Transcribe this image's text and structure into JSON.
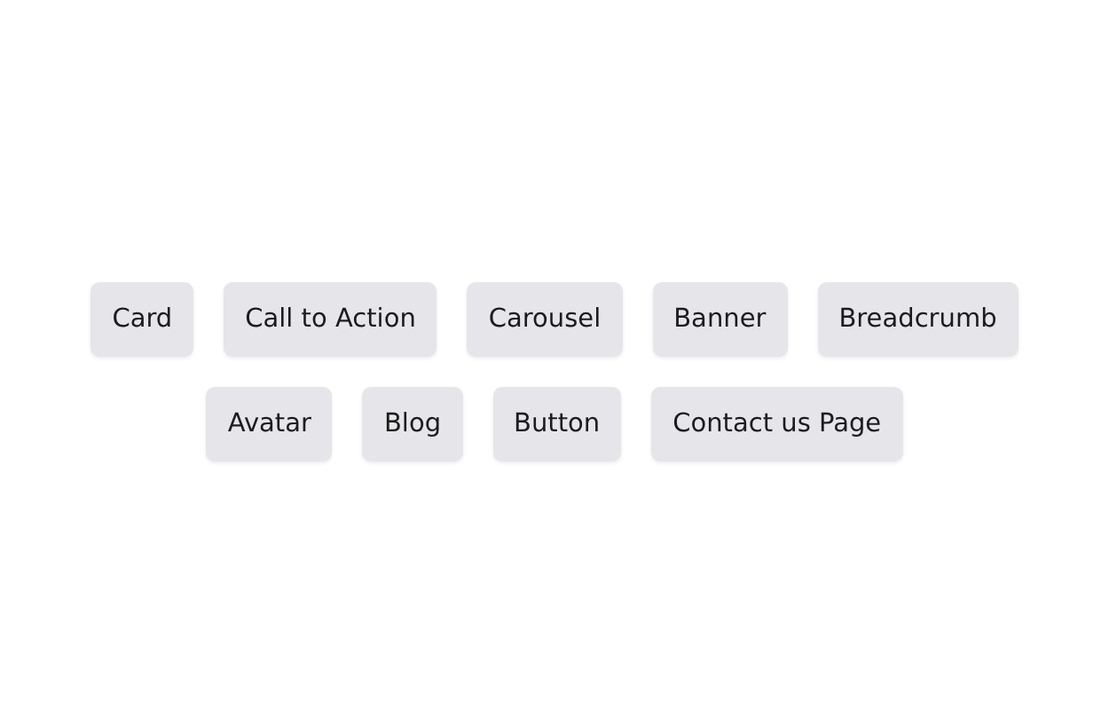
{
  "tags": [
    {
      "label": "Card"
    },
    {
      "label": "Call to Action"
    },
    {
      "label": "Carousel"
    },
    {
      "label": "Banner"
    },
    {
      "label": "Breadcrumb"
    },
    {
      "label": "Avatar"
    },
    {
      "label": "Blog"
    },
    {
      "label": "Button"
    },
    {
      "label": "Contact us Page"
    }
  ]
}
